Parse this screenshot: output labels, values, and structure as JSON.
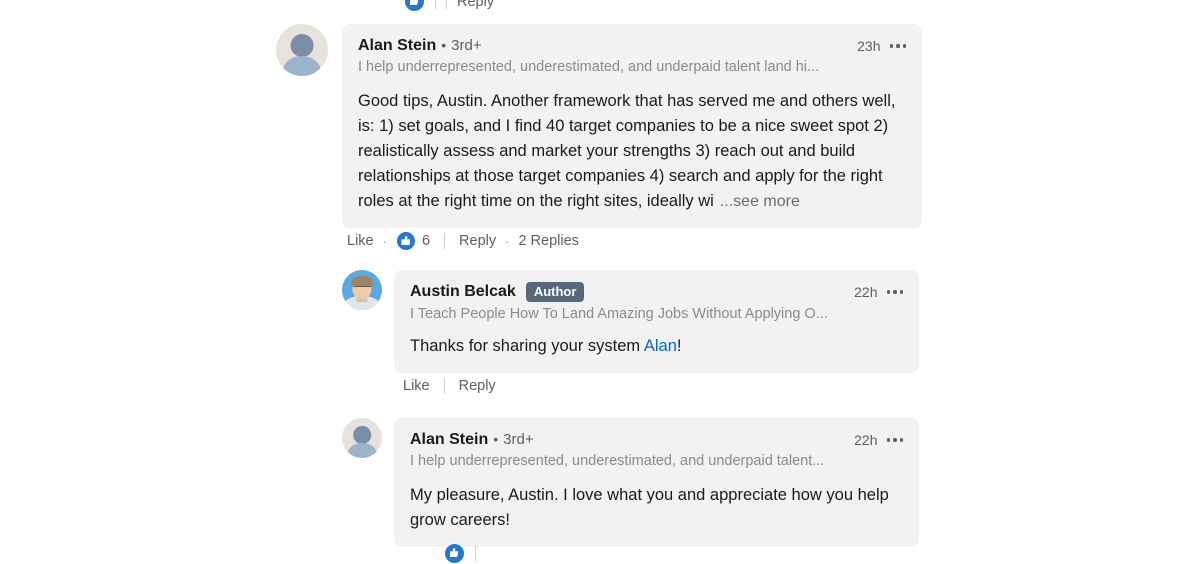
{
  "page": {
    "background_color": "#ffffff",
    "bubble_color": "#f2f2f2",
    "link_color": "#0a66c2",
    "author_badge_color": "#56687a",
    "reaction_color": "#2977c9"
  },
  "partial_rows": {
    "top": {
      "reply_label": "Reply"
    },
    "bottom": {
      "reply_label": ""
    }
  },
  "comments": [
    {
      "name": "Alan Stein",
      "separator": "•",
      "degree": "3rd+",
      "headline": "I help underrepresented, underestimated, and underpaid talent land hi...",
      "timestamp": "23h",
      "body": "Good tips, Austin. Another framework that has served me and others well, is: 1) set goals, and I find 40 target companies to be a nice sweet spot 2) realistically assess and market your strengths 3) reach out and build relationships at those target companies 4) search and apply for the right roles at the right time on the right sites, ideally wi",
      "see_more": "...see more",
      "actions": {
        "like_label": "Like",
        "dot": "·",
        "reaction_count": "6",
        "reply_label": "Reply",
        "replies_label": "2 Replies"
      }
    },
    {
      "name": "Austin Belcak",
      "badge": "Author",
      "headline": "I Teach People How To Land Amazing Jobs Without Applying O...",
      "timestamp": "22h",
      "body_prefix": "Thanks for sharing your system ",
      "body_mention": "Alan",
      "body_suffix": "!",
      "actions": {
        "like_label": "Like",
        "reply_label": "Reply"
      }
    },
    {
      "name": "Alan Stein",
      "separator": "•",
      "degree": "3rd+",
      "headline": "I help underrepresented, underestimated, and underpaid talent...",
      "timestamp": "22h",
      "body": "My pleasure, Austin. I love what you and appreciate how you help grow careers!"
    }
  ]
}
